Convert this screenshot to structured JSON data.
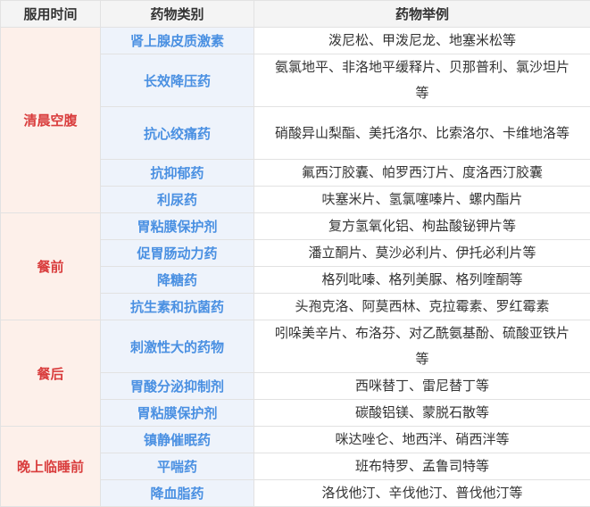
{
  "headers": [
    "服用时间",
    "药物类别",
    "药物举例"
  ],
  "colors": {
    "time_bg": "#fdf0ea",
    "category_bg": "#eef3fb",
    "time_text": "#d93d3d",
    "category_text": "#4a90e2",
    "header_bg": "#f4f4f4"
  },
  "groups": [
    {
      "time": "清晨空腹",
      "rows": [
        {
          "category": "肾上腺皮质激素",
          "examples": "泼尼松、甲泼尼龙、地塞米松等"
        },
        {
          "category": "长效降压药",
          "examples": "氨氯地平、非洛地平缓释片、贝那普利、氯沙坦片等"
        },
        {
          "category": "抗心绞痛药",
          "examples": "硝酸异山梨酯、美托洛尔、比索洛尔、卡维地洛等"
        },
        {
          "category": "抗抑郁药",
          "examples": "氟西汀胶囊、帕罗西汀片、度洛西汀胶囊"
        },
        {
          "category": "利尿药",
          "examples": "呋塞米片、氢氯噻嗪片、螺内酯片"
        }
      ]
    },
    {
      "time": "餐前",
      "rows": [
        {
          "category": "胃粘膜保护剂",
          "examples": "复方氢氧化铝、枸盐酸铋钾片等"
        },
        {
          "category": "促胃肠动力药",
          "examples": "潘立酮片、莫沙必利片、伊托必利片等"
        },
        {
          "category": "降糖药",
          "examples": "格列吡嗪、格列美脲、格列喹酮等"
        },
        {
          "category": "抗生素和抗菌药",
          "examples": "头孢克洛、阿莫西林、克拉霉素、罗红霉素"
        }
      ]
    },
    {
      "time": "餐后",
      "rows": [
        {
          "category": "刺激性大的药物",
          "examples": "吲哚美辛片、布洛芬、对乙酰氨基酚、硫酸亚铁片等"
        },
        {
          "category": "胃酸分泌抑制剂",
          "examples": "西咪替丁、雷尼替丁等"
        },
        {
          "category": "胃粘膜保护剂",
          "examples": "碳酸铝镁、蒙脱石散等"
        }
      ]
    },
    {
      "time": "晚上临睡前",
      "rows": [
        {
          "category": "镇静催眠药",
          "examples": "咪达唑仑、地西泮、硝西泮等"
        },
        {
          "category": "平喘药",
          "examples": "班布特罗、孟鲁司特等"
        },
        {
          "category": "降血脂药",
          "examples": "洛伐他汀、辛伐他汀、普伐他汀等"
        }
      ]
    }
  ]
}
